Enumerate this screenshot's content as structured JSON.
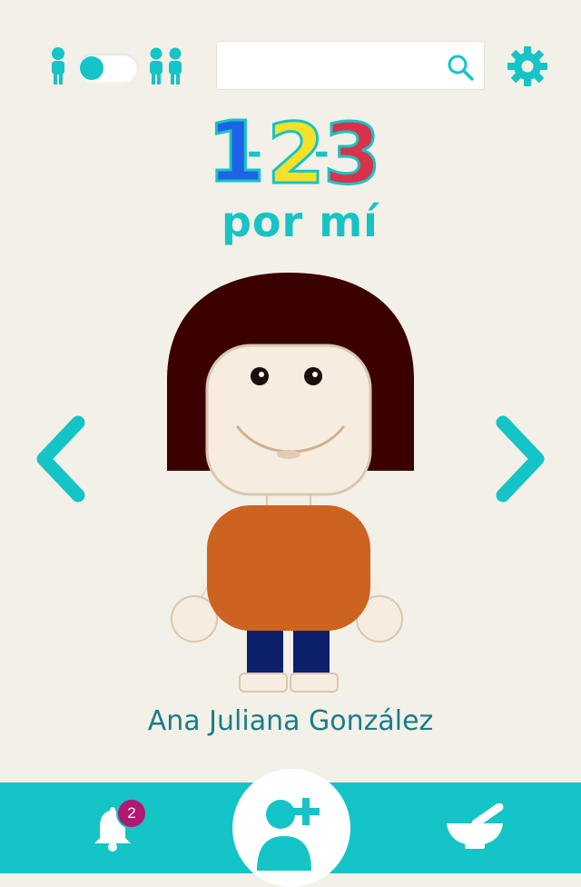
{
  "header": {
    "mode_single": "single-child-icon",
    "mode_multiple": "multiple-children-icon",
    "search": {
      "value": "",
      "placeholder": ""
    },
    "settings_icon": "gear-icon"
  },
  "logo": {
    "digit_1": "1",
    "digit_2": "2",
    "digit_3": "3",
    "sub": "por mí"
  },
  "child": {
    "name": "Ana Juliana González",
    "colors": {
      "hair": "#3b0000",
      "skin": "#f7ece0",
      "shirt": "#cc6320",
      "pants": "#0b1f6b"
    }
  },
  "bottom_bar": {
    "notifications_count": "2",
    "icons": [
      "bell-icon",
      "add-user-icon",
      "mortar-pestle-icon"
    ]
  },
  "colors": {
    "accent": "#14c4c6",
    "background": "#f3f0e8",
    "badge": "#b0196f",
    "text": "#1a7d87"
  }
}
